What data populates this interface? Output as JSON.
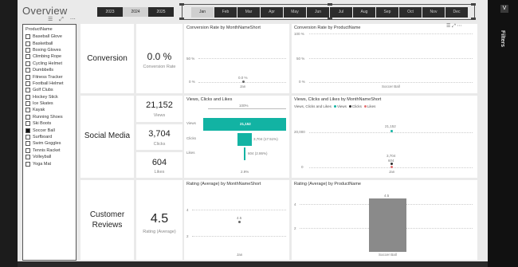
{
  "report": {
    "title": "Overview"
  },
  "years": [
    "2023",
    "2024",
    "2025"
  ],
  "selected_year": "2024",
  "months": [
    "Jan",
    "Feb",
    "Mar",
    "Apr",
    "May",
    "Jun",
    "Jul",
    "Aug",
    "Sep",
    "Oct",
    "Nov",
    "Dec"
  ],
  "selected_month": "Jan",
  "slicer": {
    "header": "ProductName",
    "items": [
      "Baseball Glove",
      "Basketball",
      "Boxing Gloves",
      "Climbing Rope",
      "Cycling Helmet",
      "Dumbbells",
      "Fitness Tracker",
      "Football Helmet",
      "Golf Clubs",
      "Hockey Stick",
      "Ice Skates",
      "Kayak",
      "Running Shoes",
      "Ski Boots",
      "Soccer Ball",
      "Surfboard",
      "Swim Goggles",
      "Tennis Racket",
      "Volleyball",
      "Yoga Mat"
    ],
    "checked": "Soccer Ball"
  },
  "rows": {
    "conversion": "Conversion",
    "social": "Social Media",
    "reviews_line1": "Customer",
    "reviews_line2": "Reviews"
  },
  "kpis": {
    "conversion_value": "0.0 %",
    "conversion_label": "Conversion Rate",
    "views_value": "21,152",
    "views_label": "Views",
    "clicks_value": "3,704",
    "clicks_label": "Clicks",
    "likes_value": "604",
    "likes_label": "Likes",
    "rating_value": "4.5",
    "rating_label": "Rating (Average)"
  },
  "visuals": {
    "conv_month_title": "Conversion Rate by MonthNameShort",
    "conv_product_title": "Conversion Rate by ProductName",
    "funnel_title": "Views, Clicks and Likes",
    "vcl_month_title": "Views, Clicks and Likes by MonthNameShort",
    "rating_month_title": "Rating (Average) by MonthNameShort",
    "rating_product_title": "Rating (Average) by ProductName"
  },
  "conv_month": {
    "ticks": [
      "50 %",
      "0 %"
    ],
    "point_label": "0.0 %",
    "x_label": "Jan"
  },
  "conv_product": {
    "ticks": [
      "100 %",
      "50 %",
      "0 %"
    ],
    "x_label": "Soccer Ball"
  },
  "funnel": {
    "top_label": "100%",
    "stages": [
      {
        "name": "Views",
        "value_label": "21,152"
      },
      {
        "name": "Clicks",
        "value_label": "3,704 (17.51%)"
      },
      {
        "name": "Likes",
        "value_label": "604 (2.86%)"
      }
    ],
    "bottom_label": "2.9%"
  },
  "vcl_month": {
    "legend_title": "Views, Clicks and Likes",
    "legend": [
      "Views",
      "Clicks",
      "Likes"
    ],
    "ticks": [
      "20,000",
      "0"
    ],
    "views_label": "21,152",
    "clicks_label": "3,704",
    "likes_label": "604",
    "x_label": "Jan"
  },
  "rating_month": {
    "ticks": [
      "4",
      "2"
    ],
    "point_label": "4.5",
    "x_label": "Jan"
  },
  "rating_product": {
    "ticks": [
      "4",
      "2"
    ],
    "bar_label": "4.5",
    "x_label": "Soccer Ball"
  },
  "chart_data": [
    {
      "type": "line",
      "title": "Conversion Rate by MonthNameShort",
      "categories": [
        "Jan"
      ],
      "values": [
        0.0
      ],
      "ylim": [
        0,
        50
      ]
    },
    {
      "type": "bar",
      "title": "Conversion Rate by ProductName",
      "categories": [
        "Soccer Ball"
      ],
      "values": [
        0.0
      ],
      "ylim": [
        0,
        100
      ]
    },
    {
      "type": "bar",
      "title": "Views, Clicks and Likes",
      "categories": [
        "Views",
        "Clicks",
        "Likes"
      ],
      "values": [
        21152,
        3704,
        604
      ]
    },
    {
      "type": "scatter",
      "title": "Views, Clicks and Likes by MonthNameShort",
      "categories": [
        "Jan"
      ],
      "series": [
        {
          "name": "Views",
          "values": [
            21152
          ]
        },
        {
          "name": "Clicks",
          "values": [
            3704
          ]
        },
        {
          "name": "Likes",
          "values": [
            604
          ]
        }
      ]
    },
    {
      "type": "line",
      "title": "Rating (Average) by MonthNameShort",
      "categories": [
        "Jan"
      ],
      "values": [
        4.5
      ]
    },
    {
      "type": "bar",
      "title": "Rating (Average) by ProductName",
      "categories": [
        "Soccer Ball"
      ],
      "values": [
        4.5
      ]
    }
  ],
  "colors": {
    "teal": "#12b3a3",
    "clicks": "#2b2b2b",
    "likes": "#e57373",
    "bar_gray": "#8a8a8a"
  },
  "filters_pane": {
    "label": "Filters"
  }
}
